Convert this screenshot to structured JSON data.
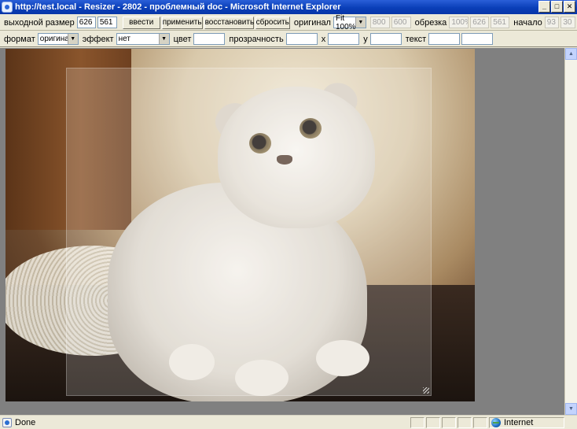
{
  "window": {
    "title": "http://test.local - Resizer - 2802 - проблемный doc - Microsoft Internet Explorer",
    "controls": {
      "minimize": "_",
      "maximize": "□",
      "close": "✕"
    }
  },
  "toolbar1": {
    "output_size_label": "выходной размер",
    "output_width": "626",
    "output_height": "561",
    "enter_button": "ввести",
    "apply_button": "применить",
    "restore_button": "восстановить",
    "reset_button": "сбросить",
    "original_label": "оригинал",
    "fit_select_value": "Fit 100%",
    "orig_width": "800",
    "orig_height": "600",
    "crop_label": "обрезка",
    "crop_percent": "100%",
    "crop_width": "626",
    "crop_height": "561",
    "start_label": "начало",
    "start_x": "93",
    "start_y": "30"
  },
  "toolbar2": {
    "format_label": "формат",
    "format_value": "оригинал",
    "effect_label": "эффект",
    "effect_value": "нет",
    "color_label": "цвет",
    "color_value": "",
    "opacity_label": "прозрачность",
    "opacity_value": "",
    "x_label": "x",
    "x_value": "",
    "y_label": "y",
    "y_value": "",
    "text_label": "текст",
    "text_value": "",
    "extra_value": ""
  },
  "status": {
    "text": "Done",
    "zone": "Internet"
  },
  "icons": {
    "app": "ie-page-icon",
    "zone": "globe-icon",
    "scroll_up": "▲",
    "scroll_down": "▼",
    "select_arrow": "▼"
  },
  "colors": {
    "title_bar": "#0a3fb8",
    "chrome": "#ece9d8",
    "content_background": "#808080"
  }
}
